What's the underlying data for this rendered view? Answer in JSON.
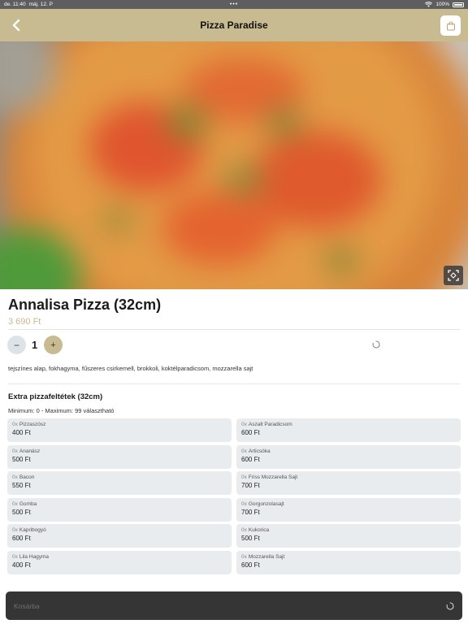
{
  "status_bar": {
    "time": "de. 11:40",
    "date": "máj. 12. P",
    "dots": "•••",
    "battery": "100%"
  },
  "header": {
    "title": "Pizza Paradise",
    "back_icon": "chevron-left-icon",
    "cart_icon": "shopping-bag-icon"
  },
  "colors": {
    "accent": "#c8bb91",
    "price": "#c9b98b",
    "tile_bg": "#e8ecee",
    "bottom_bar": "#353535"
  },
  "hero": {
    "fullscreen_icon": "expand-icon"
  },
  "product": {
    "name": "Annalisa Pizza (32cm)",
    "price": "3 690 Ft",
    "quantity": "1",
    "minus_label": "−",
    "plus_label": "+",
    "ingredients": "tejszínes alap, fokhagyma, fűszeres csirkemell, brokkoli, koktélparadicsom, mozzarella sajt"
  },
  "extras": {
    "title": "Extra pizzafeltétek (32cm)",
    "limits": "Minimum: 0 - Maximum: 99 választható",
    "items": [
      {
        "count": "0x",
        "name": "Pizzaszósz",
        "price": "400 Ft"
      },
      {
        "count": "0x",
        "name": "Aszalt Paradicsom",
        "price": "600 Ft"
      },
      {
        "count": "0x",
        "name": "Ananász",
        "price": "500 Ft"
      },
      {
        "count": "0x",
        "name": "Articsóka",
        "price": "600 Ft"
      },
      {
        "count": "0x",
        "name": "Bacon",
        "price": "550 Ft"
      },
      {
        "count": "0x",
        "name": "Friss Mozzarella Sajt",
        "price": "700 Ft"
      },
      {
        "count": "0x",
        "name": "Gomba",
        "price": "500 Ft"
      },
      {
        "count": "0x",
        "name": "Gorgonzolasajt",
        "price": "700 Ft"
      },
      {
        "count": "0x",
        "name": "Kapribogyó",
        "price": "600 Ft"
      },
      {
        "count": "0x",
        "name": "Kukorica",
        "price": "500 Ft"
      },
      {
        "count": "0x",
        "name": "Lila Hagyma",
        "price": "400 Ft"
      },
      {
        "count": "0x",
        "name": "Mozzarella Sajt",
        "price": "600 Ft"
      }
    ]
  },
  "cart_bar": {
    "label": "Kosárba"
  }
}
